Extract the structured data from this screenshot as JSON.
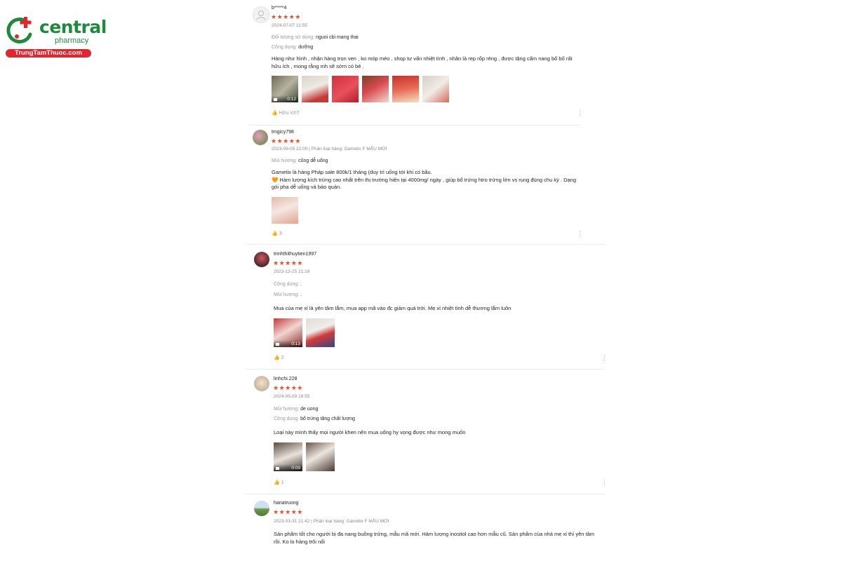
{
  "logo": {
    "brand": "central",
    "sub": "pharmacy",
    "site": "TrungTamThuoc.com"
  },
  "reviews": [
    {
      "username": "b*****4",
      "stars": "★★★★★",
      "date": "2024-07-07 11:55",
      "attrs": [
        {
          "k": "Đối tượng sử dụng: ",
          "v": "nguoi cbi mang thai"
        },
        {
          "k": "Công dụng: ",
          "v": "dưỡng"
        }
      ],
      "body": "Hàng như hình , nhận hàng trọn vẹn , ko móp méo , shop tư vấn nhiệt tình , nhân là rep rốp rẻng , được tặng cẩm nang bổ bố rất hữu ích , mong rằng mh sẽ sớm có bé .",
      "video_duration": "0:12",
      "likes": "Hữu ích?"
    },
    {
      "username": "tmgicy798",
      "stars": "★★★★★",
      "date": "2023-09-05 22:00 | Phân loại hàng: Gametix F MẪU MỚI",
      "attrs": [
        {
          "k": "Mùi hương: ",
          "v": "cũng dễ uống"
        }
      ],
      "body_line1": "Gametix là hàng Pháp sale 800k/1 tháng (duy trì uống tới khi có bầu.",
      "body_line2": "🧡 Hàm lượng kích trứng cao nhất trên thị trường hiện tại 4000mg/ ngày , giúp bổ trứng htro trứng lớn vs rụng đúng chu kỳ . Dạng gói pha dễ uống và bảo quản.",
      "likes": "3"
    },
    {
      "username": "trinhthithuytien1997",
      "stars": "★★★★★",
      "date": "2023-12-25 21:19",
      "attrs": [
        {
          "k": "Công dụng: ",
          "v": "."
        },
        {
          "k": "Mùi hương: ",
          "v": "."
        }
      ],
      "body": "Mua của mẹ xỉ là yên tâm lắm, mua app mã vào đc giảm quá trời. Mẹ xỉ nhiệt tình dễ thương lắm luôn",
      "video_duration": "0:13",
      "likes": "2"
    },
    {
      "username": "linhchi.228",
      "stars": "★★★★★",
      "date": "2024-05-09 18:55",
      "attrs": [
        {
          "k": "Mùi hương: ",
          "v": "de uong"
        },
        {
          "k": "Công dụng: ",
          "v": "bổ trứng tăng chất lượng"
        }
      ],
      "body": "Loại này mình thấy mọi người khen nên mua uống hy vọng được như mong muốn",
      "video_duration": "0:09",
      "likes": "1"
    },
    {
      "username": "hanatruong",
      "stars": "★★★★★",
      "date": "2023-03-31 21:42 | Phân loại hàng: Gametix F MẪU MỚI",
      "body": "Sản phẩm tốt cho người bị đa nang buồng trứng, mẫu mã mới. Hàm lượng inositol cao hơn mẫu cũ. Sản phẩm của nhà mẹ xỉ thì yên tâm rồi. Ko lo hàng trôi nổi"
    }
  ],
  "colors": {
    "star": "#ee4d2d",
    "brand_green": "#1f8a3e",
    "brand_red": "#e0262f"
  }
}
